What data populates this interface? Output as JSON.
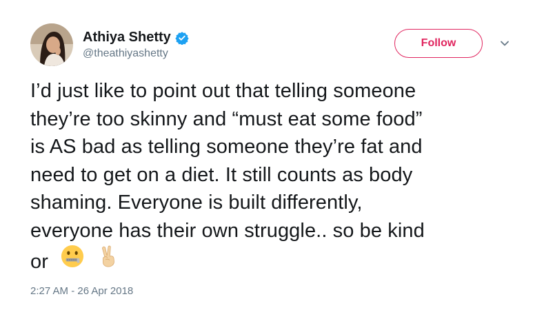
{
  "user": {
    "name": "Athiya Shetty",
    "handle": "@theathiyashetty",
    "verified": true
  },
  "actions": {
    "follow_label": "Follow"
  },
  "tweet": {
    "lines": [
      "I’d just like to point out that telling someone",
      "they’re too skinny and “must eat some food”",
      "is AS bad as telling someone they’re fat and",
      "need to get on a diet. It still counts as body",
      "shaming. Everyone is built differently,",
      "everyone has their own struggle.. so be kind",
      "or"
    ],
    "emojis": [
      "zipper-mouth-face-icon",
      "victory-hand-icon"
    ],
    "timestamp": "2:27 AM - 26 Apr 2018"
  },
  "colors": {
    "follow_accent": "#e0245e",
    "verified_blue": "#1da1f2",
    "secondary_text": "#657786",
    "primary_text": "#14171a"
  }
}
